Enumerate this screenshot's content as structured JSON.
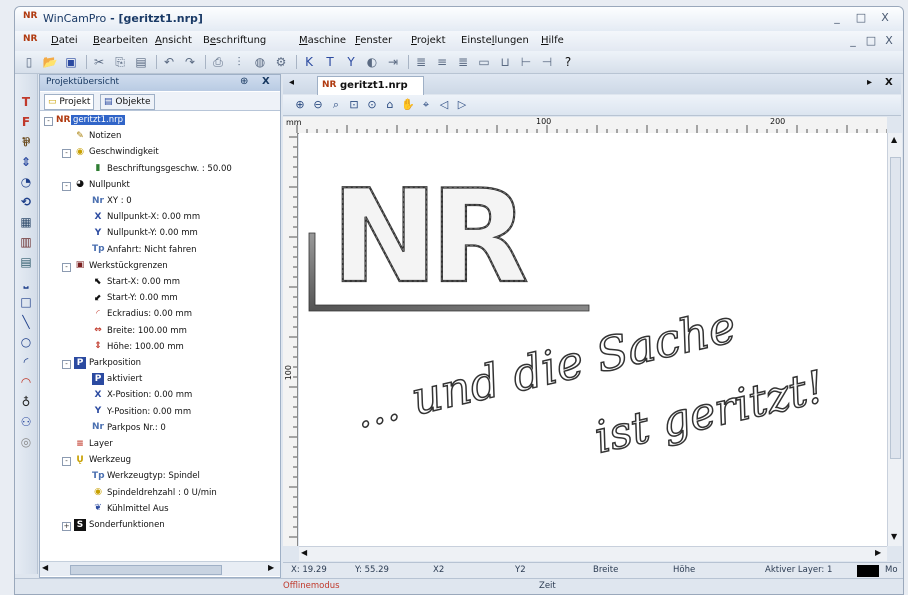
{
  "window": {
    "app": "WinCamPro",
    "document_title": "[geritzt1.nrp]",
    "controls": [
      "_",
      "□",
      "X"
    ],
    "mdi_controls": [
      "_",
      "□",
      "X"
    ]
  },
  "menu": [
    {
      "label": "Datei",
      "key": "D"
    },
    {
      "label": "Bearbeiten",
      "key": "B"
    },
    {
      "label": "Ansicht",
      "key": "A"
    },
    {
      "label": "Beschriftung",
      "key": "e"
    },
    {
      "label": "Maschine",
      "key": "M"
    },
    {
      "label": "Fenster",
      "key": "F"
    },
    {
      "label": "Projekt",
      "key": "P"
    },
    {
      "label": "Einstellungen",
      "key": "l"
    },
    {
      "label": "Hilfe",
      "key": "H"
    }
  ],
  "toolbar_icons": [
    "new-icon",
    "open-icon",
    "save-icon",
    "cut-icon",
    "copy-icon",
    "paste-icon",
    "undo-icon",
    "redo-icon",
    "print-icon",
    "align-icon",
    "layer-icon",
    "gear-icon",
    "text-icon",
    "bold-icon",
    "kerning-icon",
    "fill-icon",
    "export-icon",
    "align-left-icon",
    "align-center-icon",
    "align-right-icon",
    "frame-icon",
    "spacing-icon",
    "spacing-h-icon",
    "spacing-v-icon",
    "help-icon"
  ],
  "left_tools": [
    {
      "glyph": "T",
      "color": "#c0392b",
      "name": "text-tool-icon"
    },
    {
      "glyph": "F",
      "color": "#c0392b",
      "name": "font-tool-icon"
    },
    {
      "glyph": "⅌",
      "color": "#6b4b1e",
      "name": "node-tool-icon"
    },
    {
      "glyph": "⇕",
      "color": "#2b4aa0",
      "name": "move-tool-icon"
    },
    {
      "glyph": "◔",
      "color": "#1e3f8a",
      "name": "rotate-tool-icon"
    },
    {
      "glyph": "⟲",
      "color": "#1e3f8a",
      "name": "mirror-tool-icon"
    },
    {
      "glyph": "▦",
      "color": "#2e4a6b",
      "name": "grid-tool-icon"
    },
    {
      "glyph": "▥",
      "color": "#6b2e2e",
      "name": "columns-tool-icon"
    },
    {
      "glyph": "▤",
      "color": "#2e5a6b",
      "name": "block-tool-icon"
    },
    {
      "glyph": "⎵",
      "color": "#1e3f8a",
      "name": "baseline-tool-icon"
    },
    {
      "glyph": "□",
      "color": "#1e3f8a",
      "name": "rectangle-tool-icon"
    },
    {
      "glyph": "╲",
      "color": "#1e3f8a",
      "name": "line-tool-icon"
    },
    {
      "glyph": "○",
      "color": "#1e3f8a",
      "name": "circle-tool-icon"
    },
    {
      "glyph": "◜",
      "color": "#1e3f8a",
      "name": "arc-tool-icon"
    },
    {
      "glyph": "◠",
      "color": "#c0392b",
      "name": "curve-tool-icon"
    },
    {
      "glyph": "♁",
      "color": "#222",
      "name": "point-tool-icon"
    },
    {
      "glyph": "⚇",
      "color": "#2b4aa0",
      "name": "link-tool-icon"
    },
    {
      "glyph": "◎",
      "color": "#888",
      "name": "target-tool-icon"
    }
  ],
  "project_panel": {
    "title": "Projektübersicht",
    "pin": "⊕",
    "close": "X",
    "tabs": [
      "Projekt",
      "Objekte"
    ],
    "tree": [
      {
        "level": 0,
        "label": "geritzt1.nrp",
        "icon": "NR",
        "color": "#b03a10",
        "expander": "-",
        "selected": true,
        "name": "project-root-icon"
      },
      {
        "level": 1,
        "label": "Notizen",
        "icon": "✎",
        "color": "#a67c00",
        "name": "notes-icon"
      },
      {
        "level": 1,
        "label": "Geschwindigkeit",
        "icon": "◉",
        "color": "#c8a000",
        "expander": "-",
        "name": "speed-icon"
      },
      {
        "level": 2,
        "label": "Beschriftungsgeschw. : 50.00",
        "icon": "▮",
        "color": "#2e7d32",
        "name": "speed-bar-icon"
      },
      {
        "level": 1,
        "label": "Nullpunkt",
        "icon": "◕",
        "color": "#111",
        "expander": "-",
        "name": "origin-icon"
      },
      {
        "level": 2,
        "label": "XY : 0",
        "icon": "Nr",
        "color": "#4a6fb0",
        "name": "xy-icon"
      },
      {
        "level": 2,
        "label": "Nullpunkt-X: 0.00 mm",
        "icon": "X",
        "color": "#2b4aa0",
        "name": "x-axis-icon"
      },
      {
        "level": 2,
        "label": "Nullpunkt-Y: 0.00 mm",
        "icon": "Y",
        "color": "#2b4aa0",
        "name": "y-axis-icon"
      },
      {
        "level": 2,
        "label": "Anfahrt: Nicht fahren",
        "icon": "Tp",
        "color": "#4a6fb0",
        "name": "approach-icon"
      },
      {
        "level": 1,
        "label": "Werkstückgrenzen",
        "icon": "▣",
        "color": "#7a2020",
        "expander": "-",
        "name": "workpiece-icon"
      },
      {
        "level": 2,
        "label": "Start-X: 0.00 mm",
        "icon": "⬉",
        "color": "#111",
        "name": "start-x-icon"
      },
      {
        "level": 2,
        "label": "Start-Y: 0.00 mm",
        "icon": "⬋",
        "color": "#111",
        "name": "start-y-icon"
      },
      {
        "level": 2,
        "label": "Eckradius: 0.00 mm",
        "icon": "◜",
        "color": "#c0392b",
        "name": "corner-radius-icon"
      },
      {
        "level": 2,
        "label": "Breite: 100.00 mm",
        "icon": "⇔",
        "color": "#c0392b",
        "name": "width-icon"
      },
      {
        "level": 2,
        "label": "Höhe: 100.00 mm",
        "icon": "⇕",
        "color": "#c0392b",
        "name": "height-icon"
      },
      {
        "level": 1,
        "label": "Parkposition",
        "icon": "P",
        "color": "#ffffff",
        "bg": "#2b4aa0",
        "expander": "-",
        "name": "park-icon"
      },
      {
        "level": 2,
        "label": "aktiviert",
        "icon": "P",
        "color": "#ffffff",
        "bg": "#2b4aa0",
        "name": "park-enabled-icon"
      },
      {
        "level": 2,
        "label": "X-Position: 0.00 mm",
        "icon": "X",
        "color": "#2b4aa0",
        "name": "park-x-icon"
      },
      {
        "level": 2,
        "label": "Y-Position: 0.00 mm",
        "icon": "Y",
        "color": "#2b4aa0",
        "name": "park-y-icon"
      },
      {
        "level": 2,
        "label": "Parkpos Nr.: 0",
        "icon": "Nr",
        "color": "#4a6fb0",
        "name": "park-number-icon"
      },
      {
        "level": 1,
        "label": "Layer",
        "icon": "≡",
        "color": "#c0392b",
        "name": "layer-icon"
      },
      {
        "level": 1,
        "label": "Werkzeug",
        "icon": "Ų",
        "color": "#c8a000",
        "expander": "-",
        "name": "tool-icon"
      },
      {
        "level": 2,
        "label": "Werkzeugtyp: Spindel",
        "icon": "Tp",
        "color": "#4a6fb0",
        "name": "tool-type-icon"
      },
      {
        "level": 2,
        "label": "Spindeldrehzahl : 0 U/min",
        "icon": "◉",
        "color": "#c8a000",
        "name": "spindle-speed-icon"
      },
      {
        "level": 2,
        "label": "Kühlmittel Aus",
        "icon": "❦",
        "color": "#2b4aa0",
        "name": "coolant-icon"
      },
      {
        "level": 1,
        "label": "Sonderfunktionen",
        "icon": "S",
        "color": "#ffffff",
        "bg": "#111",
        "expander": "+",
        "name": "special-functions-icon"
      }
    ]
  },
  "doc": {
    "tab_label": "geritzt1.nrp",
    "nav_left": "◂",
    "nav_right": "▸",
    "close": "X"
  },
  "zoom_icons": [
    "zoom-in-icon",
    "zoom-out-icon",
    "zoom-fit-icon",
    "zoom-window-icon",
    "zoom-previous-icon",
    "zoom-all-icon",
    "zoom-pan-icon",
    "zoom-select-icon",
    "zoom-back-icon",
    "zoom-forward-icon"
  ],
  "ruler": {
    "h_labels": [
      "mm",
      "100",
      "200"
    ],
    "v_labels": [
      "100"
    ]
  },
  "canvas": {
    "logo_text": "NR",
    "line1": "... und die Sache",
    "line2": "ist geritzt!"
  },
  "status": {
    "x": "X: 19.29",
    "y": "Y: 55.29",
    "x2": "X2",
    "y2": "Y2",
    "breite": "Breite",
    "hoehe": "Höhe",
    "layer": "Aktiver Layer: 1",
    "mode": "Mo"
  },
  "bottom": {
    "offline": "Offlinemodus",
    "zeit": "Zeit"
  }
}
